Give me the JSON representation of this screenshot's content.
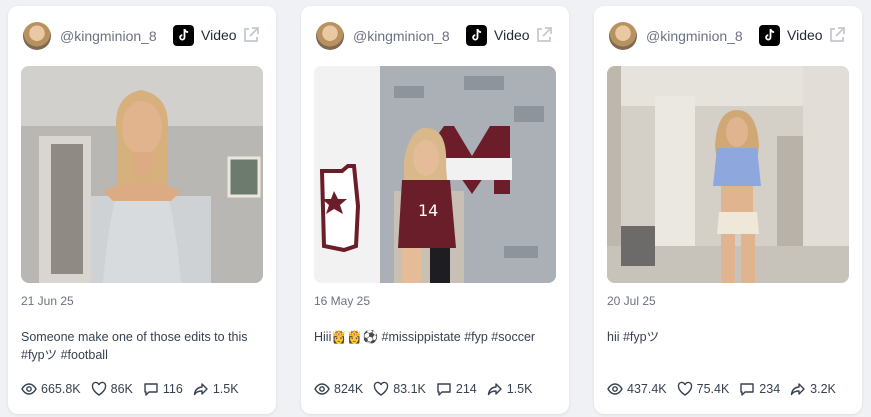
{
  "posts": [
    {
      "handle": "@kingminion_8",
      "platform_label": "Video",
      "date": "21 Jun 25",
      "caption": "Someone make one of those edits to this #fypツ #football",
      "stats": {
        "views": "665.8K",
        "likes": "86K",
        "comments": "116",
        "shares": "1.5K"
      }
    },
    {
      "handle": "@kingminion_8",
      "platform_label": "Video",
      "date": "16 May 25",
      "caption": "Hiii👸👸⚽ #missippistate #fyp #soccer",
      "stats": {
        "views": "824K",
        "likes": "83.1K",
        "comments": "214",
        "shares": "1.5K"
      }
    },
    {
      "handle": "@kingminion_8",
      "platform_label": "Video",
      "date": "20 Jul 25",
      "caption": "hii #fypツ",
      "stats": {
        "views": "437.4K",
        "likes": "75.4K",
        "comments": "234",
        "shares": "3.2K"
      }
    }
  ],
  "icons": {
    "avatar": "avatar",
    "platform": "tiktok-icon",
    "open": "external-link-icon",
    "views": "eye-icon",
    "likes": "heart-icon",
    "comments": "comment-icon",
    "shares": "share-icon"
  },
  "colors": {
    "background": "#f0f1f4",
    "card": "#ffffff",
    "muted_text": "#6b7280"
  }
}
